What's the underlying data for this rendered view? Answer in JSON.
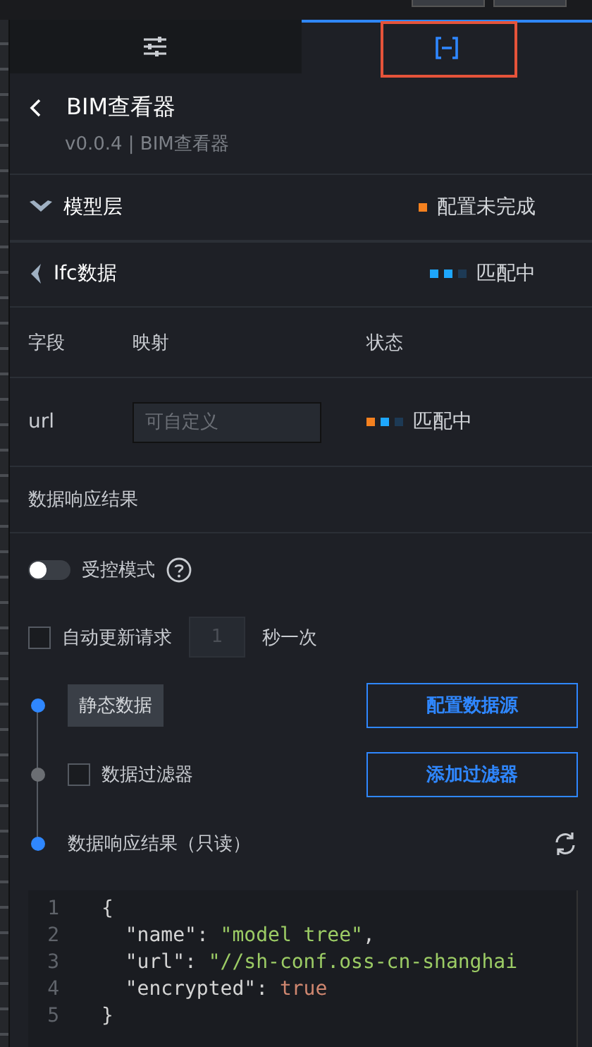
{
  "tabs": [
    {
      "kind": "sliders",
      "selected": false,
      "highlighted": false
    },
    {
      "kind": "brackets",
      "selected": true,
      "highlighted": true
    }
  ],
  "header": {
    "title": "BIM查看器",
    "subtitle": "v0.0.4 | BIM查看器"
  },
  "sections": [
    {
      "title": "模型层",
      "expanded": true,
      "status": {
        "dots": [
          {
            "color": "#f5811f"
          }
        ],
        "text": "配置未完成"
      }
    },
    {
      "title": "Ifc数据",
      "expanded": false,
      "status": {
        "dots": [
          {
            "color": "#1ea7fd"
          },
          {
            "color": "#1ea7fd"
          },
          {
            "color": "#1d3a55"
          }
        ],
        "text": "匹配中"
      }
    }
  ],
  "mapping_table": {
    "columns": [
      "字段",
      "映射",
      "状态"
    ],
    "rows": [
      {
        "field": "url",
        "placeholder": "可自定义",
        "status": {
          "dots": [
            {
              "color": "#f5811f"
            },
            {
              "color": "#1ea7fd"
            },
            {
              "color": "#1d3a55"
            }
          ],
          "text": "匹配中"
        }
      }
    ]
  },
  "response": {
    "title": "数据响应结果",
    "controlled_mode": {
      "label": "受控模式",
      "on": false
    },
    "auto_update": {
      "label": "自动更新请求",
      "checked": false,
      "interval": "1",
      "unit": "秒一次"
    },
    "steps": [
      {
        "kind": "tag",
        "label": "静态数据",
        "button": "配置数据源",
        "color": "#2f87ff"
      },
      {
        "kind": "checkbox",
        "label": "数据过滤器",
        "checked": false,
        "button": "添加过滤器",
        "color": "#6b6e73"
      },
      {
        "kind": "result",
        "label": "数据响应结果（只读）",
        "color": "#2f87ff"
      }
    ],
    "code": [
      {
        "number": "1",
        "tokens": [
          {
            "kind": "punct",
            "text": "{"
          }
        ]
      },
      {
        "number": "2",
        "tokens": [
          {
            "kind": "key",
            "text": "  \"name\""
          },
          {
            "kind": "punct",
            "text": ": "
          },
          {
            "kind": "string",
            "text": "\"model tree\""
          },
          {
            "kind": "punct",
            "text": ","
          }
        ]
      },
      {
        "number": "3",
        "tokens": [
          {
            "kind": "key",
            "text": "  \"url\""
          },
          {
            "kind": "punct",
            "text": ": "
          },
          {
            "kind": "string",
            "text": "\"//sh-conf.oss-cn-shanghai"
          }
        ]
      },
      {
        "number": "4",
        "tokens": [
          {
            "kind": "key",
            "text": "  \"encrypted\""
          },
          {
            "kind": "punct",
            "text": ": "
          },
          {
            "kind": "bool",
            "text": "true"
          }
        ]
      },
      {
        "number": "5",
        "tokens": [
          {
            "kind": "punct",
            "text": "}"
          }
        ]
      }
    ]
  }
}
